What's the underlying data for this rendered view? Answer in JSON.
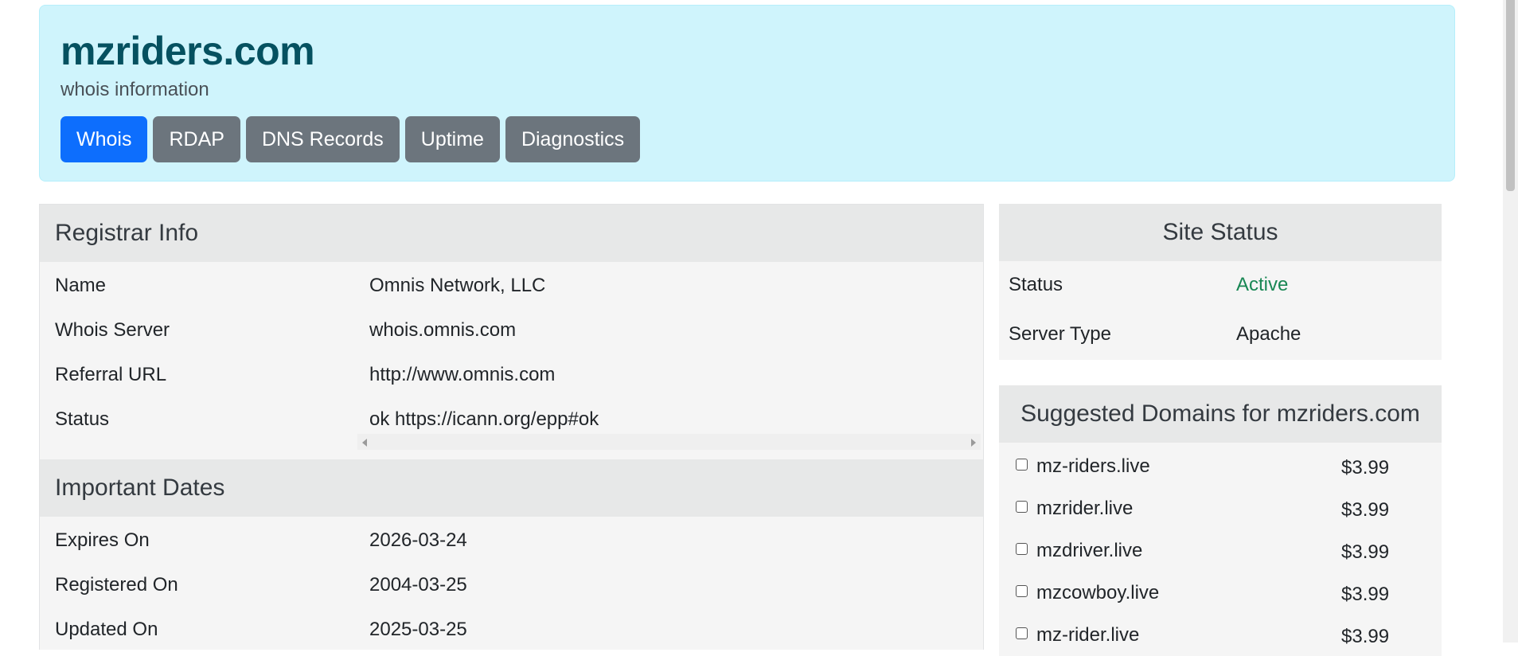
{
  "header": {
    "title": "mzriders.com",
    "subtitle": "whois information",
    "tabs": [
      {
        "label": "Whois",
        "active": true
      },
      {
        "label": "RDAP",
        "active": false
      },
      {
        "label": "DNS Records",
        "active": false
      },
      {
        "label": "Uptime",
        "active": false
      },
      {
        "label": "Diagnostics",
        "active": false
      }
    ]
  },
  "registrar": {
    "heading": "Registrar Info",
    "rows": [
      {
        "label": "Name",
        "value": "Omnis Network, LLC"
      },
      {
        "label": "Whois Server",
        "value": "whois.omnis.com"
      },
      {
        "label": "Referral URL",
        "value": "http://www.omnis.com"
      },
      {
        "label": "Status",
        "value": "ok https://icann.org/epp#ok"
      }
    ]
  },
  "dates": {
    "heading": "Important Dates",
    "rows": [
      {
        "label": "Expires On",
        "value": "2026-03-24"
      },
      {
        "label": "Registered On",
        "value": "2004-03-25"
      },
      {
        "label": "Updated On",
        "value": "2025-03-25"
      }
    ]
  },
  "site_status": {
    "heading": "Site Status",
    "rows": [
      {
        "label": "Status",
        "value": "Active"
      },
      {
        "label": "Server Type",
        "value": "Apache"
      }
    ]
  },
  "suggested": {
    "heading": "Suggested Domains for mzriders.com",
    "items": [
      {
        "name": "mz-riders.live",
        "price": "$3.99"
      },
      {
        "name": "mzrider.live",
        "price": "$3.99"
      },
      {
        "name": "mzdriver.live",
        "price": "$3.99"
      },
      {
        "name": "mzcowboy.live",
        "price": "$3.99"
      },
      {
        "name": "mz-rider.live",
        "price": "$3.99"
      }
    ]
  },
  "colors": {
    "hero_bg": "#cff4fc",
    "title": "#055160",
    "tab_active": "#0d6efd",
    "tab_inactive": "#6c757d",
    "status_active": "#198754"
  }
}
